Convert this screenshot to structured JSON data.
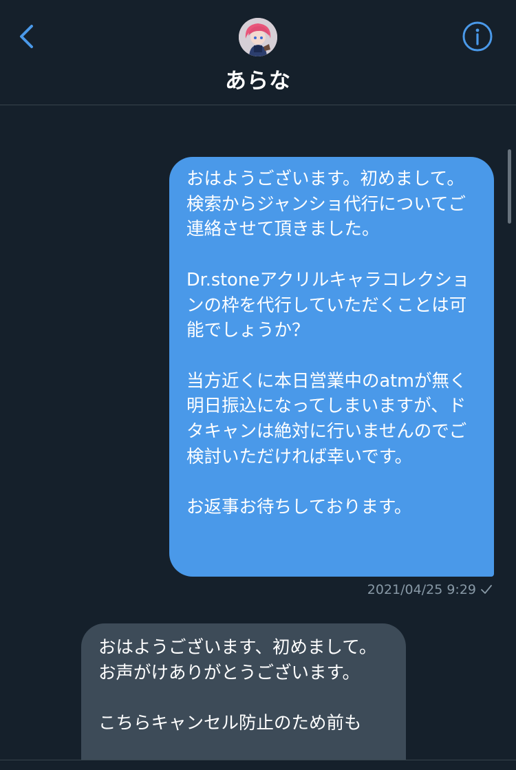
{
  "header": {
    "title": "あらな",
    "back_icon": "chevron-left-icon",
    "info_icon": "info-icon"
  },
  "colors": {
    "background": "#15202b",
    "accent": "#4a99e9",
    "incoming_bubble": "#3d4b58",
    "divider": "#38444d",
    "meta_text": "#8899a6"
  },
  "messages": [
    {
      "direction": "outgoing",
      "text": "おはようございます。初めまして。検索からジャンショ代行についてご連絡させて頂きました。\n\nDr.stoneアクリルキャラコレクションの枠を代行していただくことは可能でしょうか？\n\n当方近くに本日営業中のatmが無く明日振込になってしまいますが、ドタキャンは絶対に行いませんのでご検討いただければ幸いです。\n\nお返事お待ちしております。",
      "timestamp": "2021/04/25 9:29",
      "status_icon": "check-icon"
    },
    {
      "direction": "incoming",
      "text": "おはようございます、初めまして。お声がけありがとうございます。\n\nこちらキャンセル防止のため前も"
    }
  ]
}
